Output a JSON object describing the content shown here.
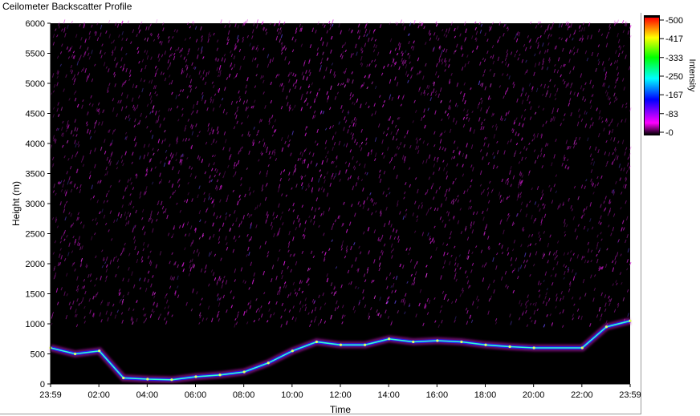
{
  "window": {
    "title": "Ceilometer Backscatter Profile"
  },
  "chart_data": {
    "type": "heatmap",
    "title": "Ceilometer Backscatter Profile",
    "xlabel": "Time",
    "ylabel": "Height (m)",
    "x_ticks": [
      "23:59",
      "02:00",
      "04:00",
      "06:00",
      "08:00",
      "10:00",
      "12:00",
      "14:00",
      "16:00",
      "18:00",
      "20:00",
      "22:00",
      "23:59"
    ],
    "y_ticks": [
      "0",
      "500",
      "1000",
      "1500",
      "2000",
      "2500",
      "3000",
      "3500",
      "4000",
      "4500",
      "5000",
      "5500",
      "6000"
    ],
    "ylim": [
      0,
      6000
    ],
    "colorbar": {
      "label": "Intensity",
      "ticks": [
        "500",
        "417",
        "333",
        "250",
        "167",
        "83",
        "0"
      ],
      "range": [
        0,
        500
      ],
      "colors": [
        "#000000",
        "#ff00ff",
        "#0000ff",
        "#00ffff",
        "#00ff00",
        "#ffff00",
        "#ff0000"
      ]
    },
    "boundary_layer_height_m": [
      {
        "time": "23:59",
        "height": 600
      },
      {
        "time": "01:00",
        "height": 500
      },
      {
        "time": "02:00",
        "height": 550
      },
      {
        "time": "03:00",
        "height": 100
      },
      {
        "time": "04:00",
        "height": 80
      },
      {
        "time": "05:00",
        "height": 70
      },
      {
        "time": "06:00",
        "height": 120
      },
      {
        "time": "07:00",
        "height": 150
      },
      {
        "time": "08:00",
        "height": 200
      },
      {
        "time": "09:00",
        "height": 350
      },
      {
        "time": "10:00",
        "height": 550
      },
      {
        "time": "11:00",
        "height": 700
      },
      {
        "time": "12:00",
        "height": 650
      },
      {
        "time": "13:00",
        "height": 650
      },
      {
        "time": "14:00",
        "height": 750
      },
      {
        "time": "15:00",
        "height": 700
      },
      {
        "time": "16:00",
        "height": 720
      },
      {
        "time": "17:00",
        "height": 700
      },
      {
        "time": "18:00",
        "height": 650
      },
      {
        "time": "19:00",
        "height": 620
      },
      {
        "time": "20:00",
        "height": 600
      },
      {
        "time": "22:00",
        "height": 600
      },
      {
        "time": "23:00",
        "height": 950
      },
      {
        "time": "23:59",
        "height": 1050
      }
    ],
    "noise_region_m": [
      1200,
      6000
    ]
  }
}
